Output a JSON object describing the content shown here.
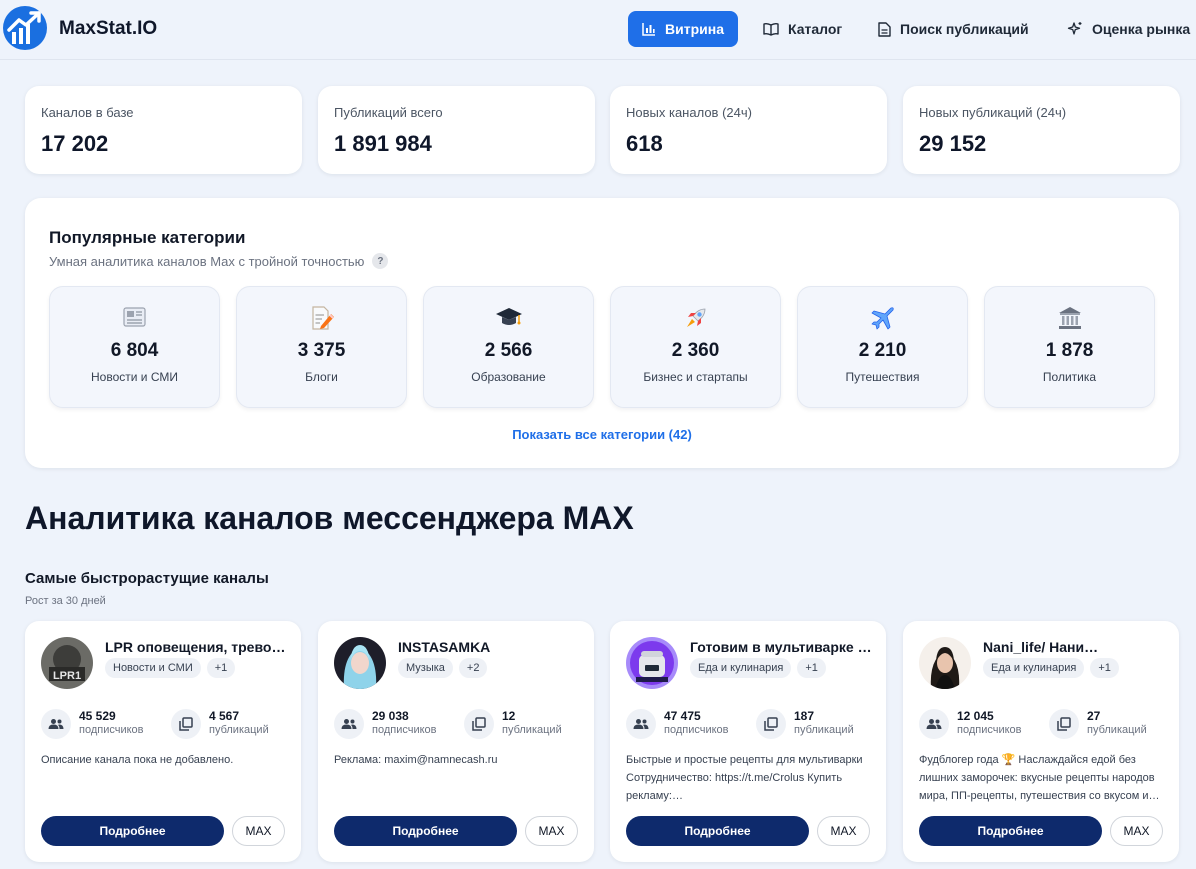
{
  "header": {
    "brand": "MaxStat.IO",
    "nav": [
      {
        "label": "Витрина",
        "icon": "bar-chart-icon",
        "active": true
      },
      {
        "label": "Каталог",
        "icon": "book-icon",
        "active": false
      },
      {
        "label": "Поиск публикаций",
        "icon": "document-icon",
        "active": false
      },
      {
        "label": "Оценка рынка",
        "icon": "sparkle-icon",
        "active": false
      }
    ]
  },
  "stats": [
    {
      "label": "Каналов в базе",
      "value": "17 202"
    },
    {
      "label": "Публикаций всего",
      "value": "1 891 984"
    },
    {
      "label": "Новых каналов (24ч)",
      "value": "618"
    },
    {
      "label": "Новых публикаций (24ч)",
      "value": "29 152"
    }
  ],
  "categories": {
    "title": "Популярные категории",
    "subtitle": "Умная аналитика каналов Max с тройной точностью",
    "help": "?",
    "items": [
      {
        "count": "6 804",
        "name": "Новости и СМИ",
        "icon": "newspaper-icon"
      },
      {
        "count": "3 375",
        "name": "Блоги",
        "icon": "memo-pencil-icon"
      },
      {
        "count": "2 566",
        "name": "Образование",
        "icon": "graduation-cap-icon"
      },
      {
        "count": "2 360",
        "name": "Бизнес и стартапы",
        "icon": "rocket-icon"
      },
      {
        "count": "2 210",
        "name": "Путешествия",
        "icon": "airplane-icon"
      },
      {
        "count": "1 878",
        "name": "Политика",
        "icon": "classical-building-icon"
      }
    ],
    "show_all": "Показать все категории (42)"
  },
  "section": {
    "title": "Аналитика каналов мессенджера MAX",
    "subtitle": "Самые быстрорастущие каналы",
    "period": "Рост за 30 дней"
  },
  "channels": [
    {
      "title": "LPR оповещения, тревог…",
      "chip": "Новости и СМИ",
      "more": "+1",
      "subscribers": "45 529",
      "subscribers_label": "подписчиков",
      "posts": "4 567",
      "posts_label": "публикаций",
      "description": "Описание канала пока не добавлено.",
      "more_button": "Подробнее",
      "max_button": "MAX"
    },
    {
      "title": "INSTASAMKA",
      "chip": "Музыка",
      "more": "+2",
      "subscribers": "29 038",
      "subscribers_label": "подписчиков",
      "posts": "12",
      "posts_label": "публикаций",
      "description": "Реклама: maxim@namnecash.ru",
      "more_button": "Подробнее",
      "max_button": "MAX"
    },
    {
      "title": "Готовим в мультиварке |…",
      "chip": "Еда и кулинария",
      "more": "+1",
      "subscribers": "47 475",
      "subscribers_label": "подписчиков",
      "posts": "187",
      "posts_label": "публикаций",
      "description": "Быстрые и простые рецепты для мультиварки Сотрудничество: https://t.me/Crolus Купить рекламу:…",
      "more_button": "Подробнее",
      "max_button": "MAX"
    },
    {
      "title": "Nani_life/ Нани…",
      "chip": "Еда и кулинария",
      "more": "+1",
      "subscribers": "12 045",
      "subscribers_label": "подписчиков",
      "posts": "27",
      "posts_label": "публикаций",
      "description": "Фудблогер года 🏆 Наслаждайся едой без лишних заморочек: вкусные рецепты народов мира, ПП-рецепты, путешествия со вкусом и…",
      "more_button": "Подробнее",
      "max_button": "MAX"
    }
  ]
}
